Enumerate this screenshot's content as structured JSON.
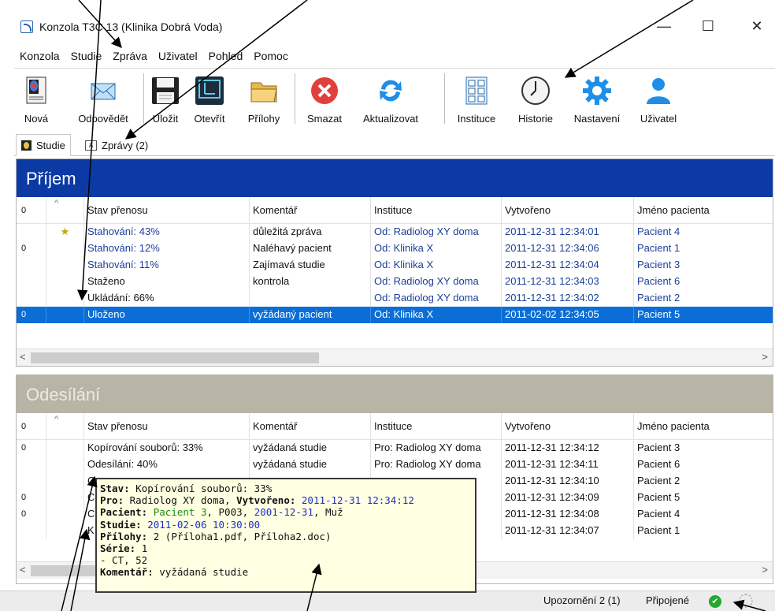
{
  "window": {
    "title": "Konzola T3C 13 (Klinika Dobrá Voda)",
    "minimize": "—",
    "maximize": "☐",
    "close": "✕"
  },
  "menu": [
    "Konzola",
    "Studie",
    "Zpráva",
    "Uživatel",
    "Pohled",
    "Pomoc"
  ],
  "toolbar": {
    "nova": "Nová",
    "odpovedet": "Odpovědět",
    "ulozit": "Uložit",
    "otevrit": "Otevřít",
    "prilohy": "Přílohy",
    "smazat": "Smazat",
    "aktualizovat": "Aktualizovat",
    "instituce": "Instituce",
    "historie": "Historie",
    "nastaveni": "Nastavení",
    "uzivatel": "Uživatel"
  },
  "tabs": {
    "studie": "Studie",
    "zpravy": "Zprávy (2)",
    "zpravy_icon_text": "A"
  },
  "columns": {
    "attach": "0",
    "sort": "^",
    "stav": "Stav přenosu",
    "komentar": "Komentář",
    "instituce": "Instituce",
    "vytvoreno": "Vytvořeno",
    "jmeno": "Jméno pacienta"
  },
  "prijem": {
    "title": "Příjem",
    "rows": [
      {
        "attach": "",
        "flag": "★",
        "stav": "Stahování: 43%",
        "komentar": "důležitá zpráva",
        "instituce": "Od: Radiolog XY doma",
        "vytvoreno": "2011-12-31 12:34:01",
        "jmeno": "Pacient 4",
        "link": true
      },
      {
        "attach": "0",
        "flag": "",
        "stav": "Stahování: 12%",
        "komentar": "Naléhavý pacient",
        "instituce": "Od: Klinika X",
        "vytvoreno": "2011-12-31 12:34:06",
        "jmeno": "Pacient 1",
        "link": true
      },
      {
        "attach": "",
        "flag": "",
        "stav": "Stahování: 11%",
        "komentar": "Zajímavá studie",
        "instituce": "Od: Klinika X",
        "vytvoreno": "2011-12-31 12:34:04",
        "jmeno": "Pacient 3",
        "link": true
      },
      {
        "attach": "",
        "flag": "",
        "stav": "Staženo",
        "komentar": "kontrola",
        "instituce": "Od: Radiolog XY doma",
        "vytvoreno": "2011-12-31 12:34:03",
        "jmeno": "Pacient 6",
        "link": false
      },
      {
        "attach": "",
        "flag": "",
        "stav": "Ukládání: 66%",
        "komentar": "",
        "instituce": "Od: Radiolog XY doma",
        "vytvoreno": "2011-12-31 12:34:02",
        "jmeno": "Pacient 2",
        "link": false
      },
      {
        "attach": "0",
        "flag": "",
        "stav": "Uloženo",
        "komentar": "vyžádaný pacient",
        "instituce": "Od: Klinika X",
        "vytvoreno": "2011-02-02 12:34:05",
        "jmeno": "Pacient 5",
        "link": false,
        "selected": true
      }
    ]
  },
  "odesilani": {
    "title": "Odesílání",
    "rows": [
      {
        "attach": "0",
        "stav": "Kopírování souborů: 33%",
        "komentar": "vyžádaná studie",
        "instituce": "Pro: Radiolog XY doma",
        "vytvoreno": "2011-12-31 12:34:12",
        "jmeno": "Pacient 3"
      },
      {
        "attach": "",
        "stav": "Odesílání: 40%",
        "komentar": "vyžádaná studie",
        "instituce": "Pro: Radiolog XY doma",
        "vytvoreno": "2011-12-31 12:34:11",
        "jmeno": "Pacient 6"
      },
      {
        "attach": "",
        "stav": "C",
        "komentar": "",
        "instituce": "oma",
        "vytvoreno": "2011-12-31 12:34:10",
        "jmeno": "Pacient 2"
      },
      {
        "attach": "0",
        "stav": "C",
        "komentar": "",
        "instituce": "",
        "vytvoreno": "2011-12-31 12:34:09",
        "jmeno": "Pacient 5"
      },
      {
        "attach": "0",
        "stav": "C",
        "komentar": "",
        "instituce": "",
        "vytvoreno": "2011-12-31 12:34:08",
        "jmeno": "Pacient 4"
      },
      {
        "attach": "",
        "stav": "K",
        "komentar": "",
        "instituce": "",
        "vytvoreno": "2011-12-31 12:34:07",
        "jmeno": "Pacient 1"
      }
    ]
  },
  "tooltip": {
    "stav_label": "Stav:",
    "stav_value": "Kopírování souborů: 33%",
    "pro_label": "Pro:",
    "pro_value": "Radiolog XY doma,",
    "vytvoreno_label": "Vytvořeno:",
    "vytvoreno_value": "2011-12-31 12:34:12",
    "pacient_label": "Pacient:",
    "pacient_name": "Pacient 3",
    "pacient_id": ", P003, ",
    "pacient_date": "2001-12-31",
    "pacient_sex": ", Muž",
    "studie_label": "Studie:",
    "studie_value": "2011-02-06 10:30:00",
    "prilohy_label": "Přílohy:",
    "prilohy_value": "2 (Příloha1.pdf, Příloha2.doc)",
    "serie_label": "Série:",
    "serie_value": "1",
    "serie_detail": "- CT, 52",
    "komentar_label": "Komentář:",
    "komentar_value": "vyžádaná studie"
  },
  "status": {
    "upozorneni": "Upozornění 2 (1)",
    "pripojene": "Připojené",
    "ok_glyph": "✔"
  },
  "colors": {
    "prijem_header": "#0b3aa5",
    "odesilani_header": "#b8b4a6",
    "selection": "#0a6ed6",
    "link": "#1b3f9a"
  }
}
